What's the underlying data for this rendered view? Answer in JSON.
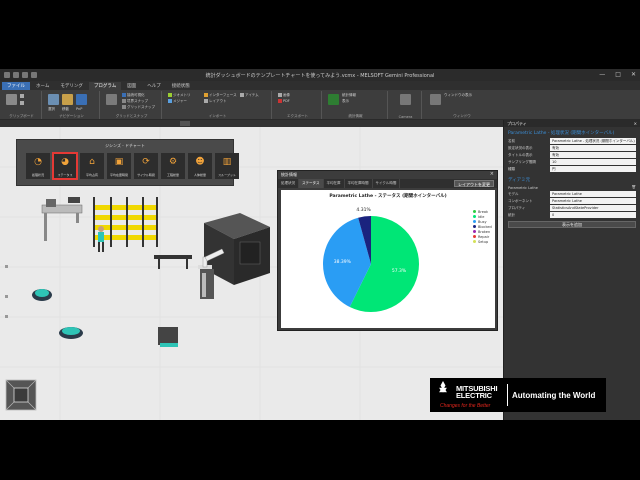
{
  "window": {
    "title": "統計ダッシュボードのテンプレートチャートを使ってみよう.vcmx - MELSOFT Gemini Professional",
    "controls": [
      "—",
      "□",
      "✕"
    ]
  },
  "menu": {
    "tabs": [
      "ファイル",
      "ホーム",
      "モデリング",
      "プログラム",
      "図面",
      "ヘルプ",
      "接続状態"
    ],
    "active_index": 3
  },
  "ribbon": {
    "groups": [
      {
        "label": "クリップボード"
      },
      {
        "label": "ナビゲーション"
      },
      {
        "label": "グリッドとスナップ"
      },
      {
        "label": "インポート"
      },
      {
        "label": "エクスポート"
      },
      {
        "label": "統計情報"
      },
      {
        "label": "Camera"
      },
      {
        "label": "ウィンドウ"
      }
    ],
    "items": [
      "選択",
      "移動",
      "PnP",
      "インタラクティブ",
      "接続可視化",
      "境界スナップ",
      "グリッドスナップ",
      "ジオメトリ",
      "メジャー",
      "インターフェース",
      "レイアウト",
      "アイテム",
      "画像",
      "PDF",
      "統計情報",
      "表示",
      "ウィンドウの表示"
    ]
  },
  "template_toolbar": {
    "title": "ジシンズ - ドチャート",
    "items": [
      "処理状況",
      "ステータス",
      "平均占有",
      "平均在庫時間",
      "サイクル時間",
      "工程総量",
      "人体総量",
      "スループット"
    ],
    "selected_index": 1
  },
  "stats_dialog": {
    "title": "統計情報",
    "close": "×",
    "tabs": [
      "処理状況",
      "ステータス",
      "平均在庫",
      "平均在庫時間",
      "サイクル時間"
    ],
    "active_tab": 1,
    "layout_button": "レイアウトを変更",
    "chart_title": "Parametric Lathe - ステータス (期間ホインターバル)"
  },
  "chart_data": {
    "type": "pie",
    "title": "Parametric Lathe - ステータス (期間ホインターバル)",
    "legend_placement": "right",
    "categories": [
      "Break",
      "Idle",
      "Busy",
      "Blocked",
      "Broken",
      "Repair",
      "Setup"
    ],
    "colors": [
      "#2ecc40",
      "#00e676",
      "#2a9df4",
      "#1a237e",
      "#9c27b0",
      "#e53935",
      "#d4e157"
    ],
    "values": [
      0,
      57.3,
      38.39,
      4.31,
      0,
      0,
      0
    ],
    "labels": [
      "",
      "57.3%",
      "38.39%",
      "4.31%",
      "",
      "",
      ""
    ]
  },
  "properties": {
    "header": "プロパティ",
    "close": "×",
    "object_title": "Parametric Lathe - 処理状況 (期間ホインターバル)",
    "rows": [
      {
        "key": "名前",
        "value": "Parametric Lathe - 処理状況 (期間ホインターバル)"
      },
      {
        "key": "設定状況の表示",
        "value": "有効"
      },
      {
        "key": "タイトルの表示",
        "value": "有効"
      },
      {
        "key": "サンプリング間隔",
        "value": "10"
      },
      {
        "key": "種類",
        "value": "円"
      }
    ],
    "section": "ディアミ元",
    "source_label": "Parametric Lathe",
    "source_rows": [
      {
        "key": "モデル",
        "value": "Parametric Lathe"
      },
      {
        "key": "コンポーネント",
        "value": "Parametric Lathe"
      },
      {
        "key": "プロパティ",
        "value": "StatisticsAndStateProvider"
      },
      {
        "key": "統計",
        "value": "0"
      }
    ],
    "add_button": "表示を追加"
  },
  "brand": {
    "name_line1": "MITSUBISHI",
    "name_line2": "ELECTRIC",
    "tagline": "Changes for the Better",
    "slogan": "Automating the World"
  }
}
